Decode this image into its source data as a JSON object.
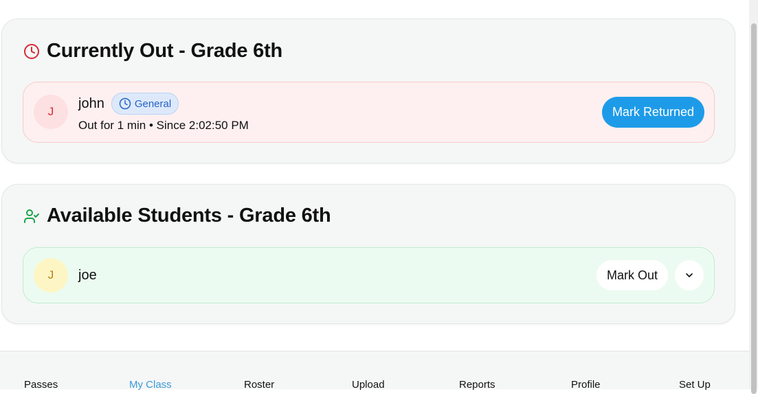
{
  "currently_out": {
    "title": "Currently Out - Grade 6th",
    "icon": "clock-icon",
    "students": [
      {
        "initial": "J",
        "name": "john",
        "badge": "General",
        "status": "Out for 1 min • Since 2:02:50 PM",
        "action": "Mark Returned"
      }
    ]
  },
  "available": {
    "title": "Available Students - Grade 6th",
    "icon": "user-check-icon",
    "students": [
      {
        "initial": "J",
        "name": "joe",
        "action": "Mark Out"
      }
    ]
  },
  "nav": {
    "active": "My Class",
    "items": [
      "Passes",
      "My Class",
      "Roster",
      "Upload",
      "Reports",
      "Profile",
      "Set Up"
    ]
  },
  "colors": {
    "accent": "#1e9be8",
    "out_bg": "#fef0f0",
    "available_bg": "#ecfbf1",
    "clock_red": "#d62a35",
    "user_green": "#1aa34a"
  }
}
